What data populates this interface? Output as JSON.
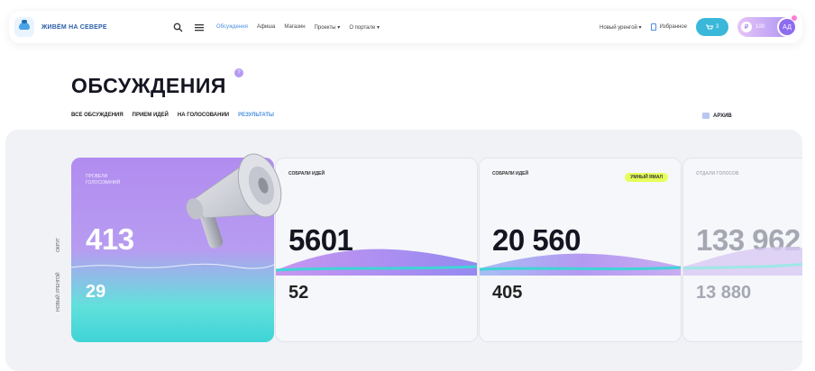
{
  "header": {
    "logo_text": "ЖИВЁМ НА СЕВЕРЕ",
    "nav": [
      {
        "label": "Обсуждения",
        "active": true
      },
      {
        "label": "Афиша",
        "active": false
      },
      {
        "label": "Магазин",
        "active": false
      },
      {
        "label": "Проекты",
        "active": false,
        "dropdown": true
      },
      {
        "label": "О портале",
        "active": false,
        "dropdown": true
      }
    ],
    "region": "Новый уренгой",
    "favorites": "Избранное",
    "cart_count": "3",
    "coins": "100",
    "avatar_initials": "АД",
    "icons": {
      "search": "search-icon",
      "menu": "menu-icon",
      "cart": "cart-icon",
      "coin": "coin-icon",
      "favorites": "bookmark-icon"
    }
  },
  "page": {
    "title": "ОБСУЖДЕНИЯ",
    "help": "?"
  },
  "tabs": [
    {
      "label": "ВСЕ ОБСУЖДЕНИЯ",
      "active": false
    },
    {
      "label": "ПРИЕМ ИДЕЙ",
      "active": false
    },
    {
      "label": "НА ГОЛОСОВАНИИ",
      "active": false
    },
    {
      "label": "РЕЗУЛЬТАТЫ",
      "active": true
    }
  ],
  "archive_label": "АРХИВ",
  "side_labels": {
    "top": "ОКРУГ",
    "bottom": "НОВЫЙ УРЕНГОЙ"
  },
  "cards": [
    {
      "caption": "ПРОВЕЛИ ГОЛОСОВАНИЙ",
      "big": "413",
      "small": "29"
    },
    {
      "caption": "СОБРАЛИ ИДЕЙ",
      "big": "5601",
      "small": "52"
    },
    {
      "caption": "СОБРАЛИ ИДЕЙ",
      "big": "20 560",
      "small": "405",
      "badge": "УМНЫЙ ЯМАЛ"
    },
    {
      "caption": "ОТДАЛИ ГОЛОСОВ",
      "big": "133 962",
      "small": "13 880"
    }
  ],
  "colors": {
    "accent": "#4a8fe0",
    "hero_top": "#b18cf0",
    "hero_bottom": "#3fd4d6",
    "badge": "#e6ff5a"
  }
}
